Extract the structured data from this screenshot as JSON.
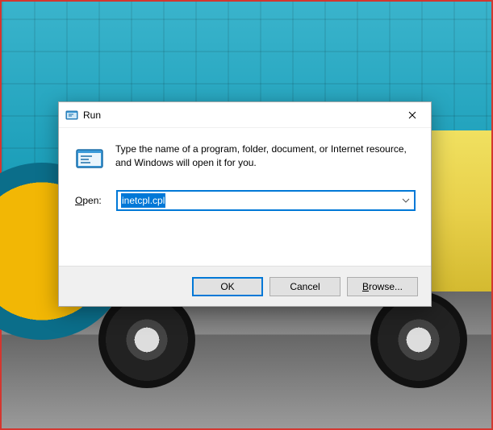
{
  "dialog": {
    "title": "Run",
    "description": "Type the name of a program, folder, document, or Internet resource, and Windows will open it for you.",
    "open_label_prefix": "O",
    "open_label_rest": "pen:",
    "input_value": "inetcpl.cpl",
    "buttons": {
      "ok": "OK",
      "cancel": "Cancel",
      "browse_prefix": "B",
      "browse_rest": "rowse..."
    }
  },
  "icons": {
    "title_icon": "run-icon",
    "main_icon": "run-icon-large",
    "close": "close-icon",
    "dropdown": "chevron-down-icon"
  }
}
